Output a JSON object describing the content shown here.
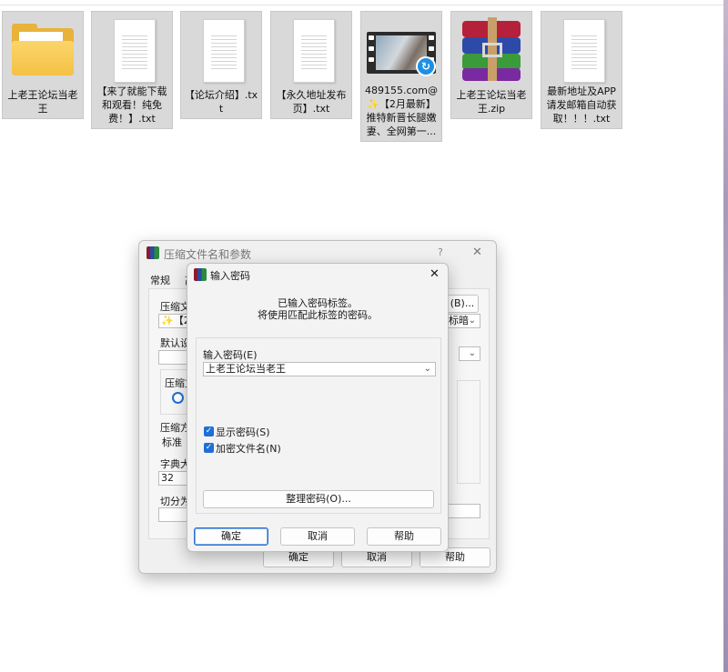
{
  "desktop": {
    "files": [
      {
        "label": "上老王论坛当老王",
        "type": "folder"
      },
      {
        "label": "【来了就能下载和观看！纯免费！】.txt",
        "type": "txt"
      },
      {
        "label": "【论坛介绍】.txt",
        "type": "txt"
      },
      {
        "label": "【永久地址发布页】.txt",
        "type": "txt"
      },
      {
        "label": "489155.com@✨【2月最新】推特新晋长腿嫩妻、全网第一...",
        "type": "video"
      },
      {
        "label": "上老王论坛当老王.zip",
        "type": "zip"
      },
      {
        "label": "最新地址及APP请发邮箱自动获取！！！.txt",
        "type": "txt"
      }
    ]
  },
  "archive_dialog": {
    "title": "压缩文件名和参数",
    "help_glyph": "?",
    "close_glyph": "✕",
    "tab_general": "常规",
    "tab_partial": "高",
    "archive_name_label": "压缩文",
    "archive_name_value": "✨【2月",
    "browse_button": "(B)...",
    "profile_value": "标暗",
    "default_profile_label": "默认设",
    "format_label": "压缩文",
    "method_label": "压缩方",
    "method_value": "标准",
    "dict_label": "字典大",
    "dict_value": "32",
    "split_label": "切分为",
    "ok_button": "确定",
    "cancel_button": "取消",
    "help_button": "帮助"
  },
  "password_dialog": {
    "title": "输入密码",
    "close_glyph": "✕",
    "info_line1": "已输入密码标签。",
    "info_line2": "将使用匹配此标签的密码。",
    "password_label": "输入密码(E)",
    "password_value": "上老王论坛当老王",
    "show_password_label": "显示密码(S)",
    "show_password_checked": true,
    "encrypt_names_label": "加密文件名(N)",
    "encrypt_names_checked": true,
    "organize_button": "整理密码(O)...",
    "ok_button": "确定",
    "cancel_button": "取消",
    "help_button": "帮助"
  },
  "colors": {
    "accent": "#1f6fd6",
    "folder": "#f4c146",
    "tile_selected": "#d9d9d9"
  }
}
